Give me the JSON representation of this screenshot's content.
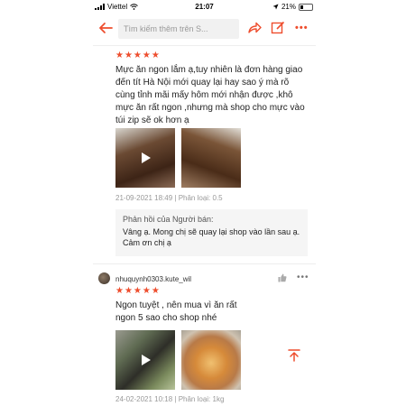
{
  "status_bar": {
    "carrier": "Viettel",
    "time": "21:07",
    "battery": "21%",
    "battery_level": 0.21
  },
  "header": {
    "search_placeholder": "Tìm kiếm thêm trên S..."
  },
  "reviews": [
    {
      "rating": "★★★★★",
      "text": "Mực ăn ngon lắm ạ,tuy nhiên là đơn hàng giao đến tít Hà Nội mới quay lại hay sao ý mà rõ cùng tỉnh mãi mấy hôm mới nhận được ,khô mực ăn rất ngon ,nhưng mà shop cho mực vào túi zip sẽ ok hơn ạ",
      "meta": "21-09-2021 18:49 | Phân loại: 0.5",
      "reply_heading": "Phản hồi của Người bán:",
      "reply_text": "Vâng ạ. Mong chị sẽ quay lại shop vào lần sau ạ. Cảm ơn chị ạ"
    },
    {
      "username": "nhuquynh0303.kute_wil",
      "rating": "★★★★★",
      "text": "Ngon tuyệt , nên mua vì ăn rất ngon 5 sao cho shop nhé ...............",
      "meta": "24-02-2021 10:18 | Phân loại: 1kg"
    }
  ],
  "icons": [
    "back-arrow-icon",
    "share-icon",
    "edit-icon",
    "more-icon",
    "thumbs-up-icon",
    "play-icon",
    "scroll-to-top-icon"
  ],
  "colors": {
    "accent": "#ee4d2d"
  }
}
